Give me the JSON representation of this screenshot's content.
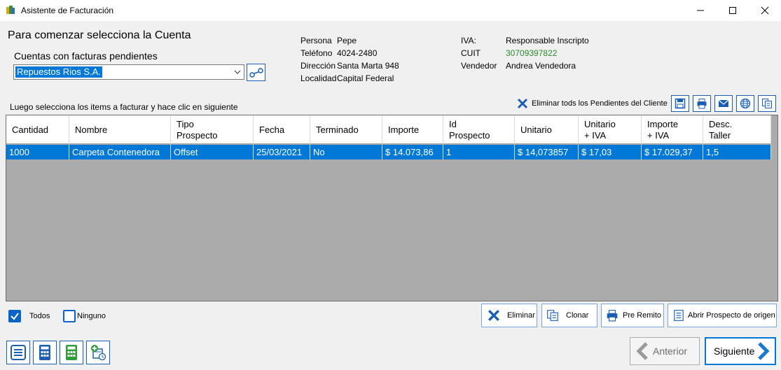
{
  "window": {
    "title": "Asistente de Facturación",
    "controls": [
      "minimize-icon",
      "maximize-icon",
      "close-icon"
    ]
  },
  "account": {
    "heading": "Para comenzar selecciona la Cuenta",
    "combo_label": "Cuentas con facturas pendientes",
    "selected": "Repuestos Rios S.A."
  },
  "client": {
    "persona_label": "Persona",
    "persona": "Pepe",
    "telefono_label": "Teléfono",
    "telefono": "4024-2480",
    "direccion_label": "Dirección",
    "direccion": "Santa Marta 948",
    "localidad_label": "Localidad",
    "localidad": "Capital Federal",
    "iva_label": "IVA:",
    "iva": "Responsable Inscripto",
    "cuit_label": "CUIT",
    "cuit": "30709397822",
    "vendedor_label": "Vendedor",
    "vendedor": "Andrea Vendedora"
  },
  "items": {
    "instruction": "Luego selecciona los items a facturar y hace clic en siguiente",
    "delete_all_label": "Eliminar tods los Pendientes del Cliente",
    "toolbar_icons": [
      "save-icon",
      "print-icon",
      "email-icon",
      "web-icon",
      "copy-icon"
    ],
    "columns": [
      "Cantidad",
      "Nombre",
      "Tipo\nProspecto",
      "Fecha",
      "Terminado",
      "Importe",
      "Id\nProspecto",
      "Unitario",
      "Unitario\n+ IVA",
      "Importe\n+ IVA",
      "Desc.\nTaller"
    ],
    "rows": [
      [
        "1000",
        "Carpeta Contenedora",
        "Offset",
        "25/03/2021",
        "No",
        "$ 14.073,86",
        "1",
        "$ 14,073857",
        "$ 17,03",
        "$ 17.029,37",
        "1,5"
      ]
    ]
  },
  "selection": {
    "todos": "Todos",
    "todos_checked": true,
    "ninguno": "Ninguno",
    "ninguno_checked": false
  },
  "actions": {
    "eliminar": "Eliminar",
    "clonar": "Clonar",
    "pre_remito": "Pre Remito",
    "abrir": "Abrir Prospecto de origen"
  },
  "tools": [
    "list-icon",
    "calculator-icon",
    "calculator-green-icon",
    "add-schedule-icon"
  ],
  "nav": {
    "anterior": "Anterior",
    "siguiente": "Siguiente"
  },
  "colors": {
    "selection": "#0078d7",
    "accent": "#1a5fb4",
    "cuit": "#2a8a2a",
    "grid_bg": "#ababab"
  }
}
